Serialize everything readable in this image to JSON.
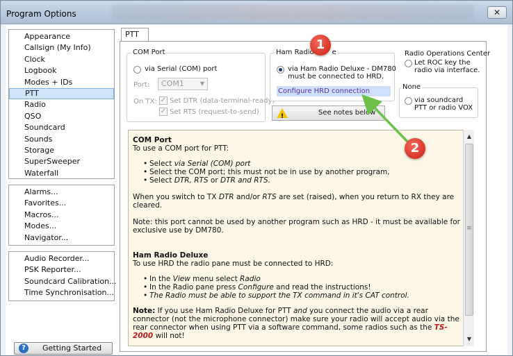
{
  "window": {
    "title": "Program Options",
    "close_label": "✕"
  },
  "sidebar": {
    "group1": [
      "Appearance",
      "Callsign (My Info)",
      "Clock",
      "Logbook",
      "Modes + IDs",
      "PTT",
      "Radio",
      "QSO",
      "Soundcard",
      "Sounds",
      "Storage",
      "SuperSweeper",
      "Waterfall"
    ],
    "selected": "PTT",
    "group2": [
      "Alarms...",
      "Favorites...",
      "Macros...",
      "Modes...",
      "Navigator..."
    ],
    "group3": [
      "Audio Recorder...",
      "PSK Reporter...",
      "Soundcard Calibration...",
      "Time Synchronisation..."
    ],
    "getting_started_label": "Getting Started"
  },
  "tab": {
    "label": "PTT"
  },
  "com_port": {
    "legend": "COM Port",
    "radio_label": "via Serial (COM) port",
    "port_label": "Port:",
    "port_value": "COM1",
    "on_tx_label": "On TX:",
    "dtr_label": "Set DTR (data-terminal-ready)",
    "rts_label": "Set RTS (request-to-send)",
    "check_mark": "✓"
  },
  "ham_radio": {
    "legend": "Ham Radio",
    "legend_tail": "e",
    "radio_label_1": "via Ham Radio Deluxe - DM780",
    "radio_label_2": "must be connected to HRD.",
    "configure_link": "Configure HRD connection",
    "notes_button": "See notes below",
    "warn_glyph": "!"
  },
  "roc": {
    "title": "Radio Operations Center",
    "radio_label_1": "Let ROC key the",
    "radio_label_2": "radio via interface."
  },
  "none_group": {
    "legend": "None",
    "radio_label_1": "via soundcard",
    "radio_label_2": "PTT or radio VOX"
  },
  "notes": {
    "com_heading": "COM Port",
    "com_intro": "To use a COM port for PTT:",
    "com_b1_a": "Select ",
    "com_b1_b": "via Serial (COM) port",
    "com_b2": "Select the COM port; this must not be in use by another program,",
    "com_b3_a": "Select ",
    "com_b3_b": "DTR, RTS",
    "com_b3_c": " or ",
    "com_b3_d": "DTR and RTS.",
    "tx_p1_a": "When you switch to TX ",
    "tx_p1_b": "DTR",
    "tx_p1_c": " and/or ",
    "tx_p1_d": "RTS",
    "tx_p1_e": " are set (raised), when you return to RX they are",
    "tx_p2": "cleared.",
    "note1_1": "Note: this port cannot be used by another program such as HRD - it must be available for",
    "note1_2": "exclusive use by DM780.",
    "hrd_heading": "Ham Radio Deluxe",
    "hrd_intro": "To use HRD the radio pane must be connected to HRD:",
    "hrd_b1_a": "In the ",
    "hrd_b1_b": "View",
    "hrd_b1_c": " menu select ",
    "hrd_b1_d": "Radio",
    "hrd_b2_a": "In the Radio pane press ",
    "hrd_b2_b": "Configure",
    "hrd_b2_c": " and read the instructions!",
    "hrd_b3": "The Radio must be able to support the TX command in it's CAT control.",
    "note2_bold": "Note:",
    "note2_1a": " If you use Ham Radio Deluxe for PTT ",
    "note2_1b": "and",
    "note2_1c": " you connect the audio via a rear",
    "note2_2": "connector (not the microphone connector) make sure your radio will accept audio via the",
    "note2_3a": "rear connector when using PTT via a software command, some radios such as the ",
    "note2_3b": "TS-",
    "note2_4a": "2000",
    "note2_4b": " will not!",
    "bullet_glyph": "•"
  },
  "scroll": {
    "up": "▲",
    "down": "▼",
    "grip": "≡"
  },
  "annotations": {
    "badge1": "1",
    "badge2": "2"
  },
  "colors": {
    "selection": "#cde4fa",
    "link": "#5a2db3",
    "badge": "#d63426",
    "arrow": "#6cc04a",
    "notes_bg": "#fbf6e6"
  }
}
